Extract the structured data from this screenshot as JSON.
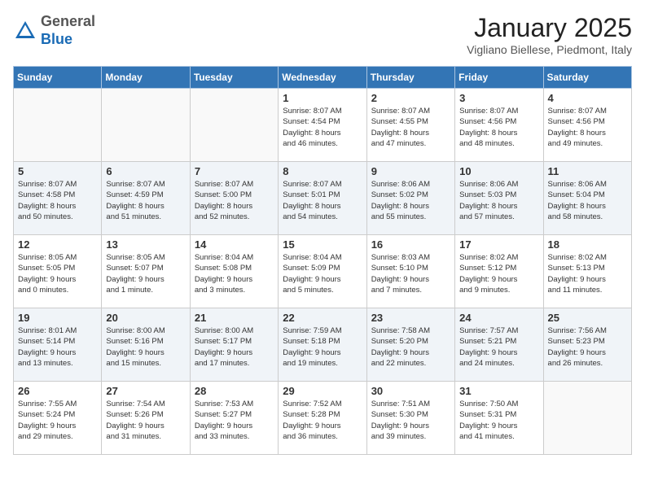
{
  "header": {
    "logo_general": "General",
    "logo_blue": "Blue",
    "month_title": "January 2025",
    "location": "Vigliano Biellese, Piedmont, Italy"
  },
  "days_of_week": [
    "Sunday",
    "Monday",
    "Tuesday",
    "Wednesday",
    "Thursday",
    "Friday",
    "Saturday"
  ],
  "weeks": [
    [
      {
        "day": "",
        "text": ""
      },
      {
        "day": "",
        "text": ""
      },
      {
        "day": "",
        "text": ""
      },
      {
        "day": "1",
        "text": "Sunrise: 8:07 AM\nSunset: 4:54 PM\nDaylight: 8 hours\nand 46 minutes."
      },
      {
        "day": "2",
        "text": "Sunrise: 8:07 AM\nSunset: 4:55 PM\nDaylight: 8 hours\nand 47 minutes."
      },
      {
        "day": "3",
        "text": "Sunrise: 8:07 AM\nSunset: 4:56 PM\nDaylight: 8 hours\nand 48 minutes."
      },
      {
        "day": "4",
        "text": "Sunrise: 8:07 AM\nSunset: 4:56 PM\nDaylight: 8 hours\nand 49 minutes."
      }
    ],
    [
      {
        "day": "5",
        "text": "Sunrise: 8:07 AM\nSunset: 4:58 PM\nDaylight: 8 hours\nand 50 minutes."
      },
      {
        "day": "6",
        "text": "Sunrise: 8:07 AM\nSunset: 4:59 PM\nDaylight: 8 hours\nand 51 minutes."
      },
      {
        "day": "7",
        "text": "Sunrise: 8:07 AM\nSunset: 5:00 PM\nDaylight: 8 hours\nand 52 minutes."
      },
      {
        "day": "8",
        "text": "Sunrise: 8:07 AM\nSunset: 5:01 PM\nDaylight: 8 hours\nand 54 minutes."
      },
      {
        "day": "9",
        "text": "Sunrise: 8:06 AM\nSunset: 5:02 PM\nDaylight: 8 hours\nand 55 minutes."
      },
      {
        "day": "10",
        "text": "Sunrise: 8:06 AM\nSunset: 5:03 PM\nDaylight: 8 hours\nand 57 minutes."
      },
      {
        "day": "11",
        "text": "Sunrise: 8:06 AM\nSunset: 5:04 PM\nDaylight: 8 hours\nand 58 minutes."
      }
    ],
    [
      {
        "day": "12",
        "text": "Sunrise: 8:05 AM\nSunset: 5:05 PM\nDaylight: 9 hours\nand 0 minutes."
      },
      {
        "day": "13",
        "text": "Sunrise: 8:05 AM\nSunset: 5:07 PM\nDaylight: 9 hours\nand 1 minute."
      },
      {
        "day": "14",
        "text": "Sunrise: 8:04 AM\nSunset: 5:08 PM\nDaylight: 9 hours\nand 3 minutes."
      },
      {
        "day": "15",
        "text": "Sunrise: 8:04 AM\nSunset: 5:09 PM\nDaylight: 9 hours\nand 5 minutes."
      },
      {
        "day": "16",
        "text": "Sunrise: 8:03 AM\nSunset: 5:10 PM\nDaylight: 9 hours\nand 7 minutes."
      },
      {
        "day": "17",
        "text": "Sunrise: 8:02 AM\nSunset: 5:12 PM\nDaylight: 9 hours\nand 9 minutes."
      },
      {
        "day": "18",
        "text": "Sunrise: 8:02 AM\nSunset: 5:13 PM\nDaylight: 9 hours\nand 11 minutes."
      }
    ],
    [
      {
        "day": "19",
        "text": "Sunrise: 8:01 AM\nSunset: 5:14 PM\nDaylight: 9 hours\nand 13 minutes."
      },
      {
        "day": "20",
        "text": "Sunrise: 8:00 AM\nSunset: 5:16 PM\nDaylight: 9 hours\nand 15 minutes."
      },
      {
        "day": "21",
        "text": "Sunrise: 8:00 AM\nSunset: 5:17 PM\nDaylight: 9 hours\nand 17 minutes."
      },
      {
        "day": "22",
        "text": "Sunrise: 7:59 AM\nSunset: 5:18 PM\nDaylight: 9 hours\nand 19 minutes."
      },
      {
        "day": "23",
        "text": "Sunrise: 7:58 AM\nSunset: 5:20 PM\nDaylight: 9 hours\nand 22 minutes."
      },
      {
        "day": "24",
        "text": "Sunrise: 7:57 AM\nSunset: 5:21 PM\nDaylight: 9 hours\nand 24 minutes."
      },
      {
        "day": "25",
        "text": "Sunrise: 7:56 AM\nSunset: 5:23 PM\nDaylight: 9 hours\nand 26 minutes."
      }
    ],
    [
      {
        "day": "26",
        "text": "Sunrise: 7:55 AM\nSunset: 5:24 PM\nDaylight: 9 hours\nand 29 minutes."
      },
      {
        "day": "27",
        "text": "Sunrise: 7:54 AM\nSunset: 5:26 PM\nDaylight: 9 hours\nand 31 minutes."
      },
      {
        "day": "28",
        "text": "Sunrise: 7:53 AM\nSunset: 5:27 PM\nDaylight: 9 hours\nand 33 minutes."
      },
      {
        "day": "29",
        "text": "Sunrise: 7:52 AM\nSunset: 5:28 PM\nDaylight: 9 hours\nand 36 minutes."
      },
      {
        "day": "30",
        "text": "Sunrise: 7:51 AM\nSunset: 5:30 PM\nDaylight: 9 hours\nand 39 minutes."
      },
      {
        "day": "31",
        "text": "Sunrise: 7:50 AM\nSunset: 5:31 PM\nDaylight: 9 hours\nand 41 minutes."
      },
      {
        "day": "",
        "text": ""
      }
    ]
  ]
}
